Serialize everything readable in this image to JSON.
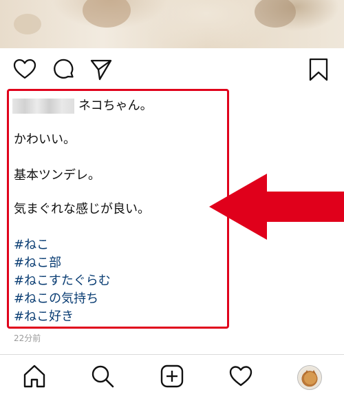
{
  "caption": {
    "first_line": "ネコちゃん。",
    "lines": [
      "かわいい。",
      "基本ツンデレ。",
      "気まぐれな感じが良い。"
    ],
    "hashtags": [
      "#ねこ",
      "#ねこ部",
      "#ねこすたぐらむ",
      "#ねこの気持ち",
      "#ねこ好き"
    ]
  },
  "timestamp": "22分前",
  "actions": {
    "icons": [
      "heart-icon",
      "comment-icon",
      "share-icon",
      "bookmark-icon"
    ]
  },
  "bottom_nav": {
    "icons": [
      "home-icon",
      "search-icon",
      "add-post-icon",
      "activity-icon",
      "profile-avatar"
    ]
  },
  "colors": {
    "highlight": "#e0001b",
    "hashtag": "#0a3d73",
    "timestamp": "#9a9a9a"
  }
}
